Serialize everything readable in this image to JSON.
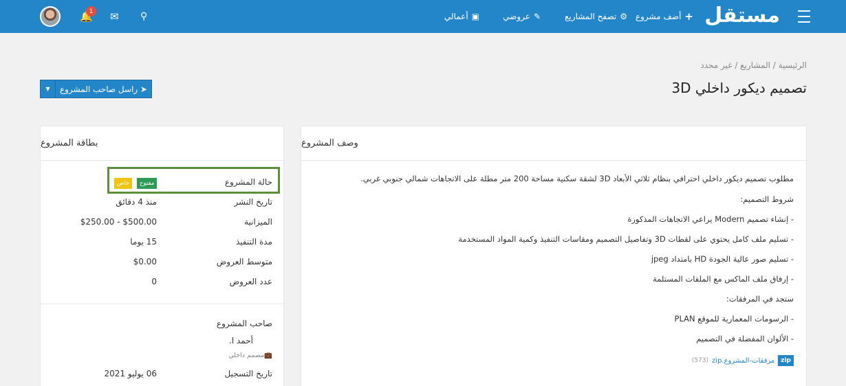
{
  "navbar": {
    "logo": "مستقل",
    "links": [
      {
        "icon": "+",
        "label": "أضف مشروع"
      },
      {
        "icon": "⚙",
        "label": "تصفح المشاريع"
      },
      {
        "icon": "✎",
        "label": "عروضي"
      },
      {
        "icon": "▣",
        "label": "أعمالي"
      }
    ],
    "notification_count": "1"
  },
  "breadcrumb": "الرئيسية / المشاريع / غير محدد",
  "page_title": "تصميم ديكور داخلي 3D",
  "contact_button": "راسل صاحب المشروع",
  "description": {
    "heading": "وصف المشروع",
    "lines": [
      "مطلوب تصميم ديكور داخلي احترافي بنظام ثلاثي الأبعاد 3D لشقة سكنية مساحة 200 متر مطلة على الاتجاهات شمالي جنوبي غربي.",
      "شروط التصميم:",
      "- إنشاء تصميم Modern يراعي الاتجاهات المذكورة",
      "- تسليم ملف كامل يحتوي على لقطات 3D وتفاصيل التصميم ومقاسات التنفيذ وكمية المواد المستخدمة",
      "- تسليم صور عالية الجودة HD بامتداد jpeg",
      "- إرفاق ملف الماكس مع الملفات المستلمة",
      "ستجد في المرفقات:",
      "- الرسومات المعمارية للموقع PLAN",
      "- الألوان المفضلة في التصميم"
    ],
    "attachment": {
      "type": "zip",
      "name": "مرفقات-المشروع.zip",
      "size": "(573)"
    }
  },
  "card": {
    "heading": "بطاقة المشروع",
    "status_label": "حالة المشروع",
    "status_open": "مفتوح",
    "status_private": "خاص",
    "rows": [
      {
        "label": "تاريخ النشر",
        "value": "منذ 4 دقائق"
      },
      {
        "label": "الميزانية",
        "value": "$250.00 - $500.00"
      },
      {
        "label": "مدة التنفيذ",
        "value": "15 يوما"
      },
      {
        "label": "متوسط العروض",
        "value": "$0.00"
      },
      {
        "label": "عدد العروض",
        "value": "0"
      }
    ],
    "owner_title": "صاحب المشروع",
    "owner_name": "أحمد ا.",
    "owner_role": "مصمم داخلي",
    "register_label": "تاريخ التسجيل",
    "register_value": "06 يوليو 2021"
  }
}
